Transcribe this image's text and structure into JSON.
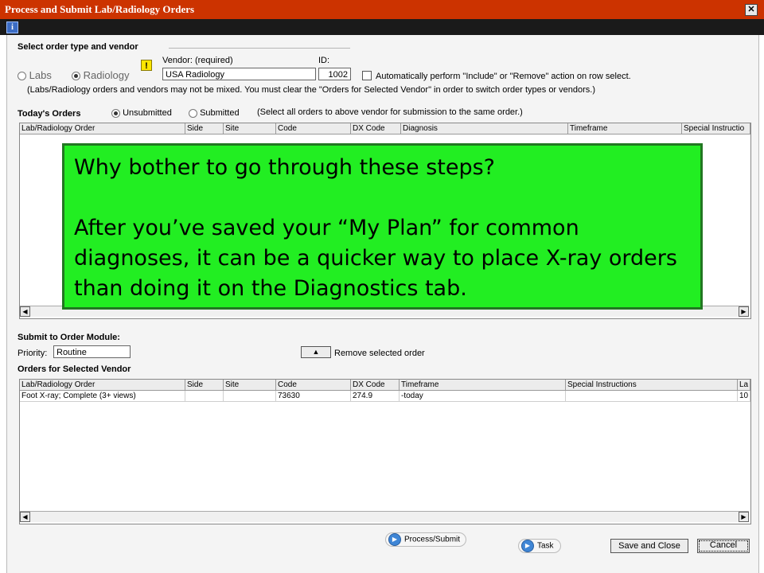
{
  "window": {
    "title": "Process and Submit Lab/Radiology Orders",
    "close_glyph": "✕",
    "info_glyph": "i"
  },
  "order_type": {
    "section_label": "Select order type and vendor",
    "labs_label": "Labs",
    "radiology_label": "Radiology",
    "selected": "Radiology",
    "warning_glyph": "!",
    "vendor_label": "Vendor: (required)",
    "vendor_value": "USA Radiology",
    "id_label": "ID:",
    "id_value": "1002",
    "auto_checkbox_label": "Automatically perform \"Include\" or \"Remove\" action on row select.",
    "auto_checked": false,
    "note": "(Labs/Radiology orders and vendors may not be mixed. You must clear the \"Orders for Selected Vendor\" in order to switch order types or vendors.)"
  },
  "todays_orders": {
    "title": "Today's Orders",
    "unsubmitted_label": "Unsubmitted",
    "submitted_label": "Submitted",
    "selected": "Unsubmitted",
    "hint": "(Select all orders to above vendor for submission to the same order.)",
    "columns": [
      "Lab/Radiology Order",
      "Side",
      "Site",
      "Code",
      "DX Code",
      "Diagnosis",
      "Timeframe",
      "Special Instructio"
    ],
    "rows": []
  },
  "callout": {
    "line1": "Why bother to go through these steps?",
    "line2": "After you’ve saved your “My Plan” for common diagnoses, it can be a quicker way to place X-ray orders than doing it on the Diagnostics tab.",
    "background": "#22ee22"
  },
  "submit_module": {
    "title": "Submit to Order Module:",
    "priority_label": "Priority:",
    "priority_value": "Routine",
    "remove_label": "Remove selected order"
  },
  "vendor_orders": {
    "title": "Orders for Selected Vendor",
    "columns": [
      "Lab/Radiology Order",
      "Side",
      "Site",
      "Code",
      "DX Code",
      "Timeframe",
      "Special Instructions",
      "La"
    ],
    "rows": [
      {
        "order": "Foot X-ray; Complete (3+ views)",
        "side": "",
        "site": "",
        "code": "73630",
        "dx_code": "274.9",
        "timeframe": "-today",
        "special": "",
        "last": "10"
      }
    ]
  },
  "footer": {
    "process_label": "Process/Submit",
    "task_label": "Task",
    "save_close_label": "Save and Close",
    "cancel_label": "Cancel"
  },
  "colors": {
    "titlebar": "#cc3300",
    "callout_border": "#227722",
    "accent_blue": "#3f86d6"
  }
}
